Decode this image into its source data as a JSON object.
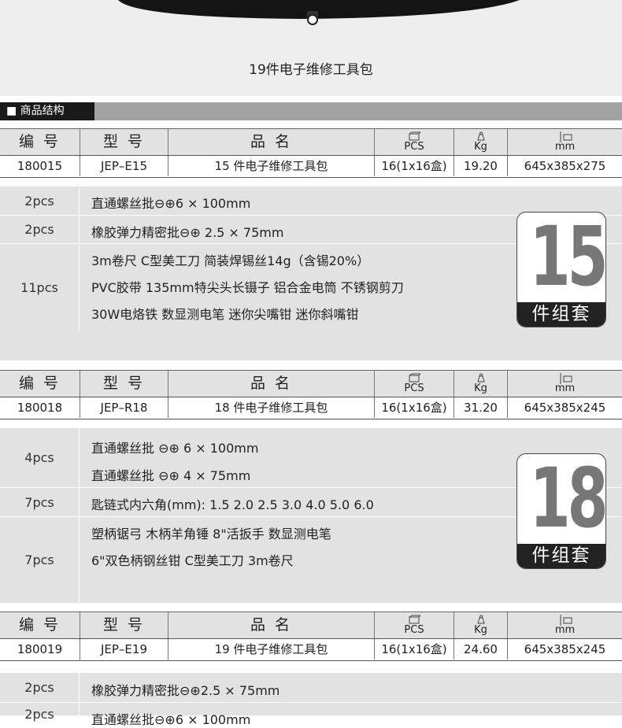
{
  "caption": "19件电子维修工具包",
  "section_tag": "■ 商品结构",
  "header": {
    "code": "编 号",
    "model": "型 号",
    "name": "品 名",
    "pcs": "PCS",
    "kg": "Kg",
    "mm": "mm"
  },
  "products": [
    {
      "code": "180015",
      "model": "JEP–E15",
      "name": "15 件电子维修工具包",
      "pcs": "16(1x16盒)",
      "kg": "19.20",
      "size": "645x385x275",
      "badge_num": "15",
      "badge_label": "件组套",
      "rows": [
        {
          "qty": "2pcs",
          "lines": [
            "直通螺丝批⊖⊕6 × 100mm"
          ]
        },
        {
          "qty": "2pcs",
          "lines": [
            "橡胶弹力精密批⊖⊕  2.5 × 75mm"
          ]
        },
        {
          "qty": "11pcs",
          "lines": [
            "3m卷尺  C型美工刀   简装焊锡丝14g（含锡20%）",
            "PVC胶带   135mm特尖头长镊子   铝合金电筒   不锈钢剪刀",
            "30W电烙铁   数显测电笔   迷你尖嘴钳   迷你斜嘴钳"
          ]
        }
      ]
    },
    {
      "code": "180018",
      "model": "JEP–R18",
      "name": "18 件电子维修工具包",
      "pcs": "16(1x16盒)",
      "kg": "31.20",
      "size": "645x385x245",
      "badge_num": "18",
      "badge_label": "件组套",
      "rows": [
        {
          "qty": "4pcs",
          "lines": [
            "直通螺丝批 ⊖⊕ 6 × 100mm",
            "直通螺丝批 ⊖⊕ 4 × 75mm"
          ]
        },
        {
          "qty": "7pcs",
          "lines": [
            "匙链式内六角(mm):  1.5   2.0   2.5   3.0   4.0   5.0   6.0"
          ]
        },
        {
          "qty": "7pcs",
          "lines": [
            "塑柄锯弓   木柄羊角锤   8\"活扳手   数显测电笔",
            "6\"双色柄钢丝钳  C型美工刀   3m卷尺"
          ]
        }
      ]
    },
    {
      "code": "180019",
      "model": "JEP–E19",
      "name": "19 件电子维修工具包",
      "pcs": "16(1x16盒)",
      "kg": "24.60",
      "size": "645x385x245",
      "rows": [
        {
          "qty": "2pcs",
          "lines": [
            "橡胶弹力精密批⊖⊕2.5 × 75mm"
          ]
        },
        {
          "qty": "2pcs",
          "lines": [
            "直通螺丝批⊖⊕6 × 100mm"
          ]
        }
      ]
    }
  ],
  "colors": {
    "header_bg": "#e2e2e2",
    "section_bar": "#a3a3a3",
    "badge_number": "#777777"
  }
}
